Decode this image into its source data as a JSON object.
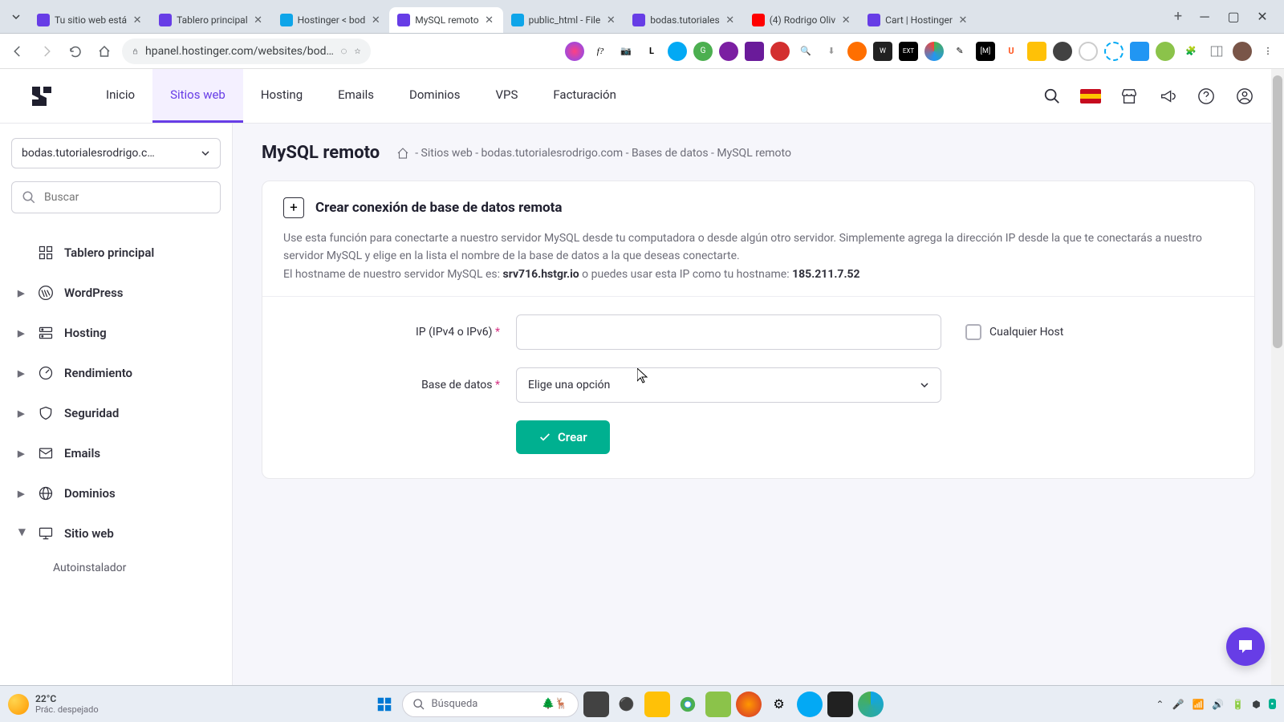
{
  "browser": {
    "tabs": [
      {
        "title": "Tu sitio web está",
        "fav": "#673de6"
      },
      {
        "title": "Tablero principal",
        "fav": "#673de6"
      },
      {
        "title": "Hostinger < bod",
        "fav": "#0ea5e9"
      },
      {
        "title": "MySQL remoto",
        "fav": "#673de6",
        "active": true
      },
      {
        "title": "public_html - File",
        "fav": "#0ea5e9"
      },
      {
        "title": "bodas.tutoriales",
        "fav": "#673de6"
      },
      {
        "title": "(4) Rodrigo Oliv",
        "fav": "#ff0000"
      },
      {
        "title": "Cart | Hostinger",
        "fav": "#673de6"
      }
    ],
    "url": "hpanel.hostinger.com/websites/bod…"
  },
  "nav": {
    "items": [
      "Inicio",
      "Sitios web",
      "Hosting",
      "Emails",
      "Dominios",
      "VPS",
      "Facturación"
    ],
    "active_index": 1
  },
  "sidebar": {
    "site_selected": "bodas.tutorialesrodrigo.c…",
    "search_placeholder": "Buscar",
    "items": [
      {
        "label": "Tablero principal",
        "icon": "dashboard",
        "chev": false
      },
      {
        "label": "WordPress",
        "icon": "wordpress",
        "chev": true
      },
      {
        "label": "Hosting",
        "icon": "server",
        "chev": true
      },
      {
        "label": "Rendimiento",
        "icon": "speed",
        "chev": true
      },
      {
        "label": "Seguridad",
        "icon": "shield",
        "chev": true
      },
      {
        "label": "Emails",
        "icon": "mail",
        "chev": true
      },
      {
        "label": "Dominios",
        "icon": "globe",
        "chev": true
      },
      {
        "label": "Sitio web",
        "icon": "monitor",
        "chev": true,
        "expanded": true
      }
    ],
    "sub_item": "Autoinstalador"
  },
  "page": {
    "title": "MySQL remoto",
    "breadcrumb": " - Sitios web - bodas.tutorialesrodrigo.com - Bases de datos - MySQL remoto",
    "card_title": "Crear conexión de base de datos remota",
    "desc_line1": "Use esta función para conectarte a nuestro servidor MySQL desde tu computadora o desde algún otro servidor. Simplemente agrega la dirección IP desde la que te conectarás a nuestro servidor MySQL y elige en la lista el nombre de la base de datos a la que deseas conectarte.",
    "desc_line2_pre": "El hostname de nuestro servidor MySQL es: ",
    "hostname": "srv716.hstgr.io",
    "desc_line2_mid": " o puedes usar esta IP como tu hostname: ",
    "ip_host": "185.211.7.52",
    "label_ip": "IP (IPv4 o IPv6)",
    "label_db": "Base de datos",
    "select_placeholder": "Elige una opción",
    "any_host": "Cualquier Host",
    "btn_create": "Crear"
  },
  "taskbar": {
    "temp": "22°C",
    "weather_desc": "Prác. despejado",
    "search_placeholder": "Búsqueda"
  }
}
